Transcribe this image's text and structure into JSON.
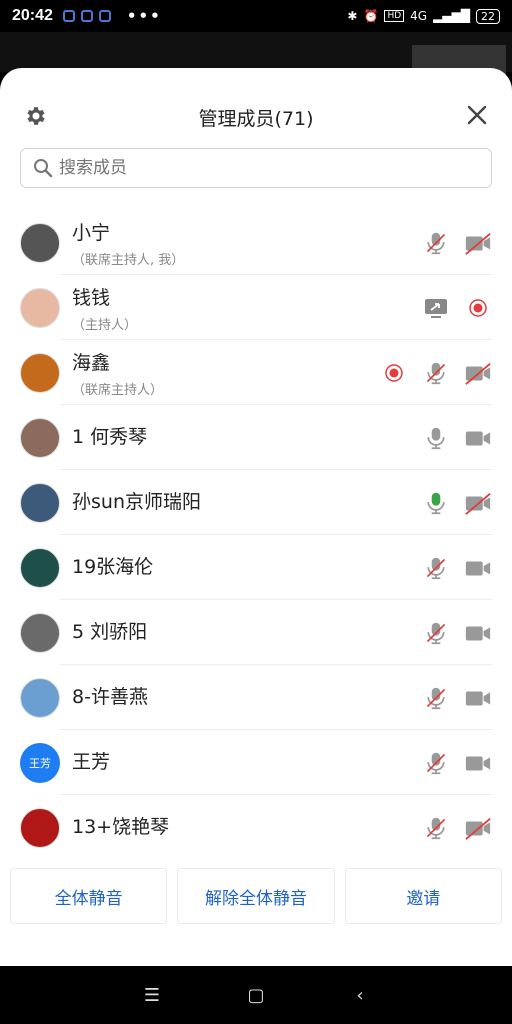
{
  "status_bar": {
    "time": "20:42",
    "dots": "•••",
    "network": "4G",
    "battery": "22"
  },
  "dialog": {
    "title": "管理成员(71)"
  },
  "search": {
    "placeholder": "搜索成员"
  },
  "members": [
    {
      "name": "小宁",
      "role": "（联席主持人, 我）",
      "mic": "muted",
      "video": "off",
      "avatar_color": "#555"
    },
    {
      "name": "钱钱",
      "role": "（主持人）",
      "share": true,
      "record": true,
      "avatar_color": "#e7b9a3"
    },
    {
      "name": "海鑫",
      "role": "（联席主持人）",
      "record": true,
      "mic": "muted",
      "video": "off",
      "avatar_color": "#c46a1d"
    },
    {
      "name": "1 何秀琴",
      "mic": "on",
      "video": "on",
      "avatar_color": "#8a6b5e"
    },
    {
      "name": "孙sun京师瑞阳",
      "mic": "speaking",
      "video": "off",
      "avatar_color": "#3d5a7a"
    },
    {
      "name": "19张海伦",
      "mic": "muted",
      "video": "on",
      "avatar_color": "#1f4f4a"
    },
    {
      "name": "5 刘骄阳",
      "mic": "muted",
      "video": "on",
      "avatar_color": "#6a6a6a"
    },
    {
      "name": "8-许善燕",
      "mic": "muted",
      "video": "on",
      "avatar_color": "#6b9fd1"
    },
    {
      "name": "王芳",
      "mic": "muted",
      "video": "on",
      "avatar_color": "#1f7df2",
      "avatar_text": "王芳"
    },
    {
      "name": "13+饶艳琴",
      "mic": "muted",
      "video": "off",
      "avatar_color": "#b01818"
    }
  ],
  "footer": {
    "mute_all": "全体静音",
    "unmute_all": "解除全体静音",
    "invite": "邀请"
  }
}
